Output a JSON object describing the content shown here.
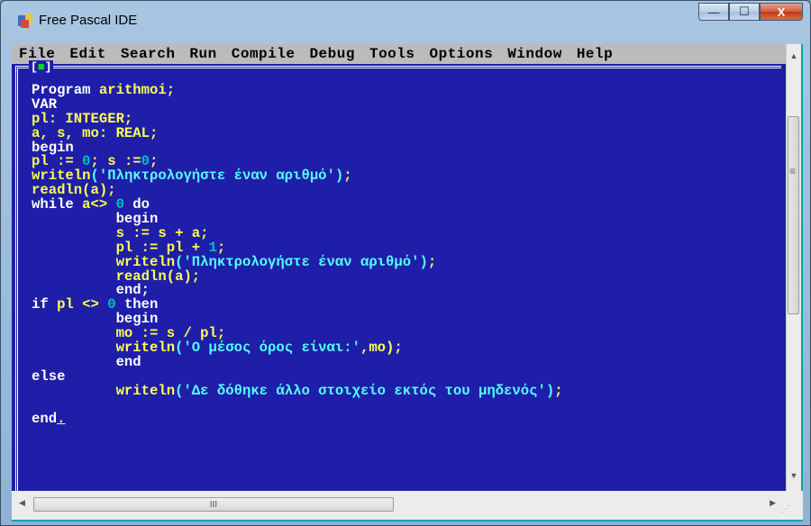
{
  "window": {
    "title": "Free Pascal IDE",
    "controls": {
      "minimize": "—",
      "maximize": "☐",
      "close": "X"
    }
  },
  "menu": [
    "File",
    "Edit",
    "Search",
    "Run",
    "Compile",
    "Debug",
    "Tools",
    "Options",
    "Window",
    "Help"
  ],
  "editor": {
    "frame_tag": "[■]",
    "lines": [
      [
        [
          "kw",
          "Program "
        ],
        [
          "id",
          "arithmoi;"
        ]
      ],
      [
        [
          "kw",
          "VAR"
        ]
      ],
      [
        [
          "id",
          "pl: INTEGER;"
        ]
      ],
      [
        [
          "id",
          "a, s, mo: REAL;"
        ]
      ],
      [
        [
          "kw",
          "begin"
        ]
      ],
      [
        [
          "id",
          "pl := "
        ],
        [
          "num",
          "0"
        ],
        [
          "id",
          "; s :="
        ],
        [
          "num",
          "0"
        ],
        [
          "id",
          ";"
        ]
      ],
      [
        [
          "id",
          "writeln"
        ],
        [
          "str",
          "('Πληκτρολογήστε έναν αριθμό')"
        ],
        [
          "id",
          ";"
        ]
      ],
      [
        [
          "id",
          "readln(a);"
        ]
      ],
      [
        [
          "kw",
          "while "
        ],
        [
          "id",
          "a<> "
        ],
        [
          "num",
          "0"
        ],
        [
          "kw",
          " do"
        ]
      ],
      [
        [
          "kw",
          "          begin"
        ]
      ],
      [
        [
          "id",
          "          s := s + a;"
        ]
      ],
      [
        [
          "id",
          "          pl := pl + "
        ],
        [
          "num",
          "1"
        ],
        [
          "id",
          ";"
        ]
      ],
      [
        [
          "id",
          "          writeln"
        ],
        [
          "str",
          "('Πληκτρολογήστε έναν αριθμό')"
        ],
        [
          "id",
          ";"
        ]
      ],
      [
        [
          "id",
          "          readln(a);"
        ]
      ],
      [
        [
          "kw",
          "          end;"
        ]
      ],
      [
        [
          "kw",
          "if "
        ],
        [
          "id",
          "pl <> "
        ],
        [
          "num",
          "0"
        ],
        [
          "kw",
          " then"
        ]
      ],
      [
        [
          "kw",
          "          begin"
        ]
      ],
      [
        [
          "id",
          "          mo := s / pl;"
        ]
      ],
      [
        [
          "id",
          "          writeln"
        ],
        [
          "str",
          "('Ο μέσος όρος είναι:'"
        ],
        [
          "id",
          ",mo);"
        ]
      ],
      [
        [
          "kw",
          "          end"
        ]
      ],
      [
        [
          "kw",
          "else"
        ]
      ],
      [
        [
          "id",
          "          writeln"
        ],
        [
          "str",
          "('Δε δόθηκε άλλο στοιχείο εκτός του μηδενός')"
        ],
        [
          "id",
          ";"
        ]
      ],
      [
        [
          "kw",
          ""
        ]
      ],
      [
        [
          "kw",
          "end"
        ],
        [
          "cursor",
          "."
        ]
      ]
    ]
  },
  "scrollbars": {
    "vertical_mid_glyph": "≡",
    "horizontal_thumb_glyph": "III"
  }
}
